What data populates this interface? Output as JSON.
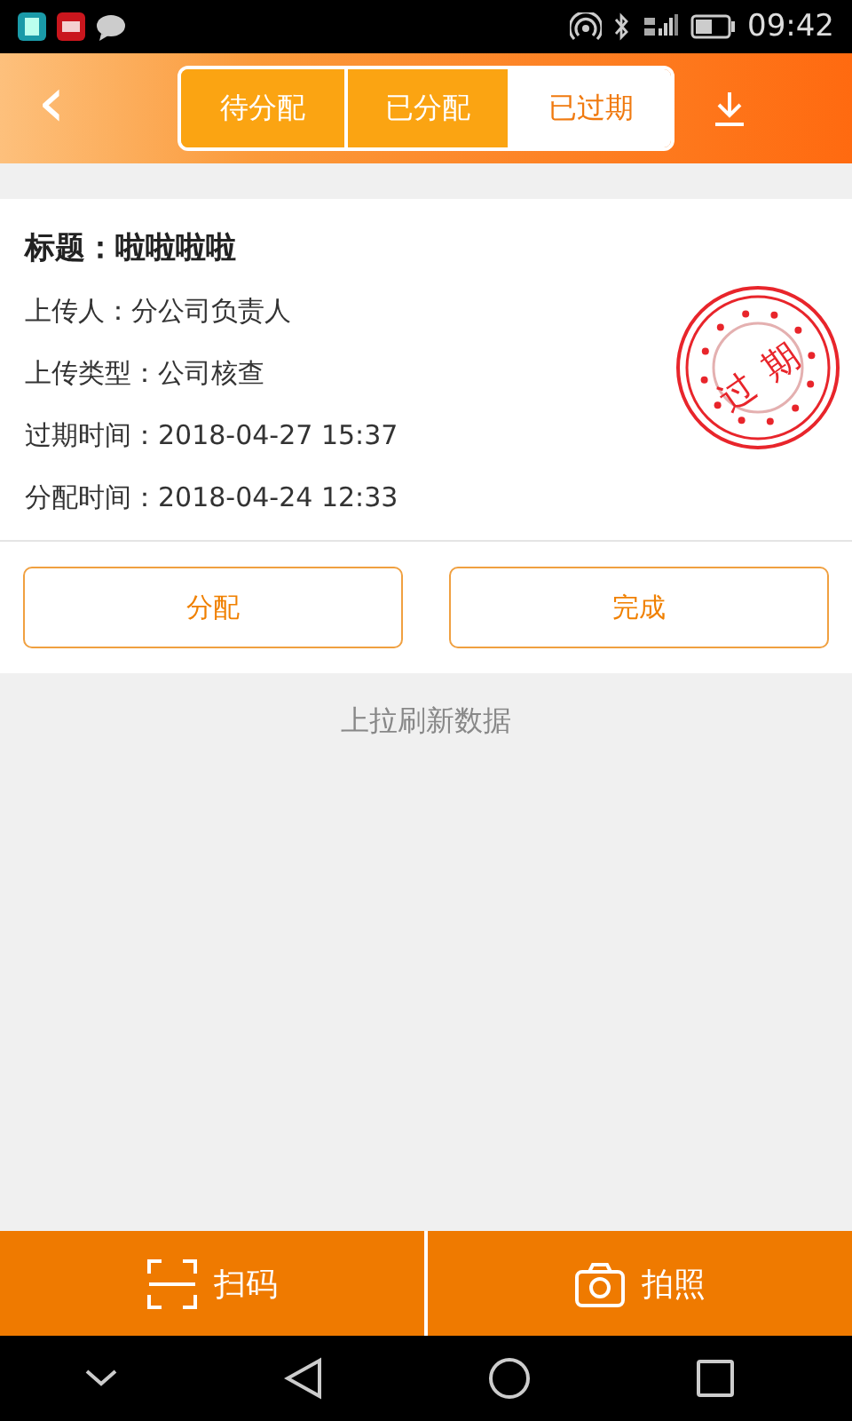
{
  "status_bar": {
    "time": "09:42"
  },
  "header": {
    "back": "‹",
    "tabs": [
      {
        "label": "待分配",
        "selected": false
      },
      {
        "label": "已分配",
        "selected": false
      },
      {
        "label": "已过期",
        "selected": true
      }
    ]
  },
  "card": {
    "title_label": "标题：",
    "title": "啦啦啦啦",
    "fields": [
      {
        "label": "上传人：",
        "value": "分公司负责人"
      },
      {
        "label": "上传类型：",
        "value": "公司核查"
      },
      {
        "label": "过期时间：",
        "value": "2018-04-27 15:37"
      },
      {
        "label": "分配时间：",
        "value": "2018-04-24 12:33"
      }
    ],
    "stamp": {
      "text": "过期"
    },
    "buttons": [
      "分配",
      "完成"
    ]
  },
  "footer_hint": "上拉刷新数据",
  "bottom_bar": [
    {
      "kind": "scan",
      "label": "扫码"
    },
    {
      "kind": "camera",
      "label": "拍照"
    }
  ]
}
